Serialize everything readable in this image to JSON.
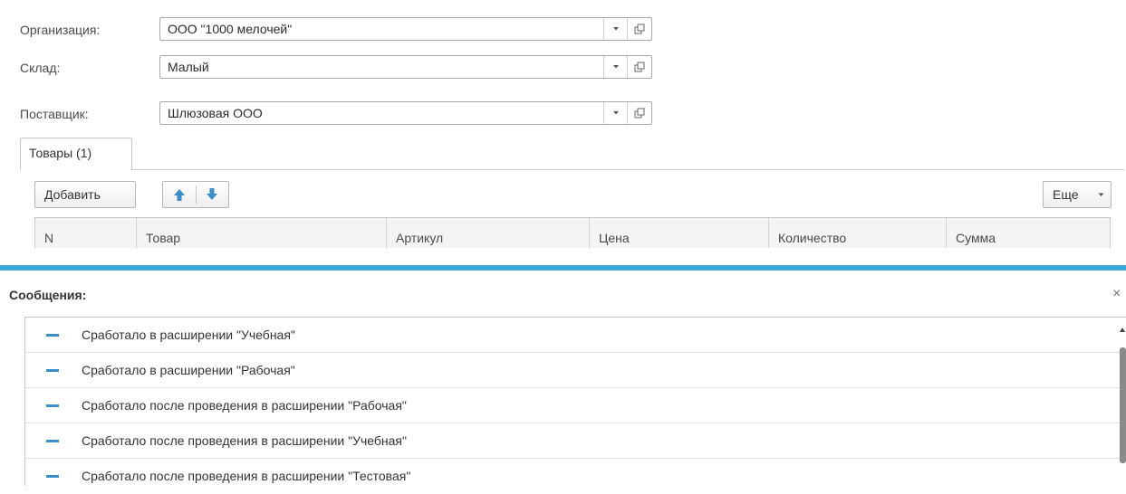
{
  "form": {
    "organization": {
      "label": "Организация:",
      "value": "ООО \"1000 мелочей\""
    },
    "warehouse": {
      "label": "Склад:",
      "value": "Малый"
    },
    "supplier": {
      "label": "Поставщик:",
      "value": "Шлюзовая ООО"
    }
  },
  "tabs": [
    {
      "label": "Товары (1)",
      "active": true
    }
  ],
  "toolbar": {
    "add_label": "Добавить",
    "more_label": "Еще"
  },
  "table": {
    "columns": [
      "N",
      "Товар",
      "Артикул",
      "Цена",
      "Количество",
      "Сумма"
    ]
  },
  "messages": {
    "title": "Сообщения:",
    "close": "×",
    "items": [
      "Сработало в расширении \"Учебная\"",
      "Сработало в расширении \"Рабочая\"",
      "Сработало после проведения в расширении \"Рабочая\"",
      "Сработало после проведения в расширении \"Учебная\"",
      "Сработало после проведения в расширении \"Тестовая\""
    ]
  },
  "colors": {
    "accent": "#3aa8d8",
    "arrow_icons": "#3b8ec8"
  },
  "icons": {
    "dropdown": "chevron-down-icon",
    "open": "open-form-icon",
    "move_up": "arrow-up-icon",
    "move_down": "arrow-down-icon",
    "message_marker": "dash-icon"
  }
}
